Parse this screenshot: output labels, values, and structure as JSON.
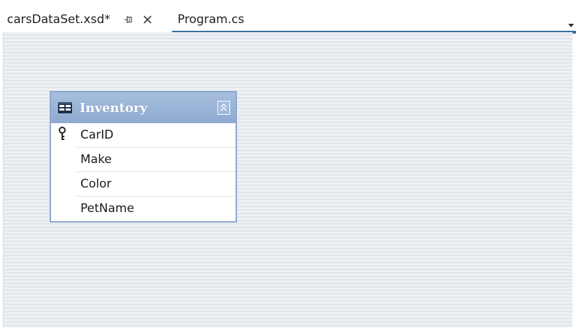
{
  "tabs": {
    "active": {
      "title": "carsDataSet.xsd*",
      "pin_icon": "pin-icon",
      "close_icon": "close-icon"
    },
    "inactive": {
      "title": "Program.cs"
    },
    "overflow_icon": "chevron-down-icon"
  },
  "designer": {
    "table": {
      "name": "Inventory",
      "icon": "table-icon",
      "collapse_icon": "collapse-up-icon",
      "columns": [
        {
          "label": "CarID",
          "primary_key": true
        },
        {
          "label": "Make",
          "primary_key": false
        },
        {
          "label": "Color",
          "primary_key": false
        },
        {
          "label": "PetName",
          "primary_key": false
        }
      ]
    }
  },
  "colors": {
    "header_blue": "#8eaad0",
    "tab_underline": "#3c6d9e",
    "table_border": "#8aa8cc",
    "surface": "#e9ecf1"
  }
}
